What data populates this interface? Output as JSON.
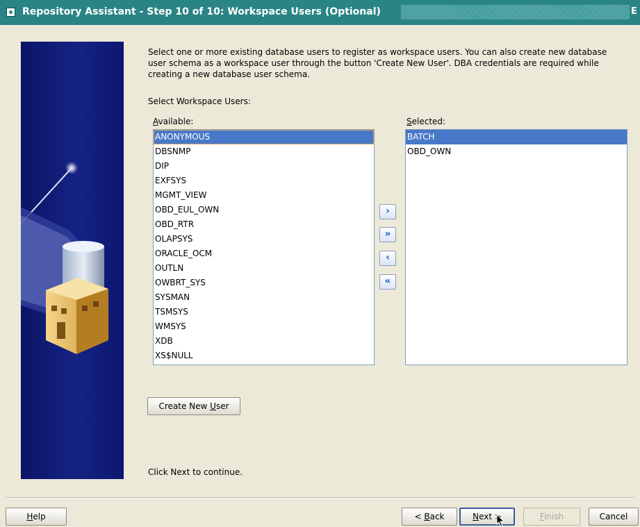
{
  "window": {
    "title": "Repository Assistant - Step 10 of 10: Workspace Users (Optional)",
    "close_glyph": "E"
  },
  "description": "Select one or more existing database users to register as workspace users. You can also create new database user schema as a workspace user through the button 'Create New User'. DBA credentials are required while creating a new database user schema.",
  "select_label": "Select Workspace Users:",
  "available": {
    "label_mnemonic": "A",
    "label_rest": "vailable:",
    "items": [
      "ANONYMOUS",
      "DBSNMP",
      "DIP",
      "EXFSYS",
      "MGMT_VIEW",
      "OBD_EUL_OWN",
      "OBD_RTR",
      "OLAPSYS",
      "ORACLE_OCM",
      "OUTLN",
      "OWBRT_SYS",
      "SYSMAN",
      "TSMSYS",
      "WMSYS",
      "XDB",
      "XS$NULL"
    ]
  },
  "selected": {
    "label_mnemonic": "S",
    "label_rest": "elected:",
    "items": [
      "BATCH",
      "OBD_OWN"
    ]
  },
  "shuttle": {
    "move": "›",
    "move_all": "»",
    "remove": "‹",
    "remove_all": "«"
  },
  "create_user_button": {
    "prefix": "Create New ",
    "mnemonic": "U",
    "suffix": "ser"
  },
  "footer_text": "Click Next to continue.",
  "buttons": {
    "help": {
      "mnemonic": "H",
      "rest": "elp"
    },
    "back": {
      "prefix": "< ",
      "mnemonic": "B",
      "rest": "ack"
    },
    "next": {
      "mnemonic": "N",
      "rest": "ext",
      "suffix": " >"
    },
    "finish": {
      "mnemonic": "F",
      "rest": "inish"
    },
    "cancel": "Cancel"
  },
  "colors": {
    "titlebar": "#2a8486",
    "selection": "#4878c8",
    "side_panel": "#0b1466",
    "background": "#ece9d8"
  }
}
